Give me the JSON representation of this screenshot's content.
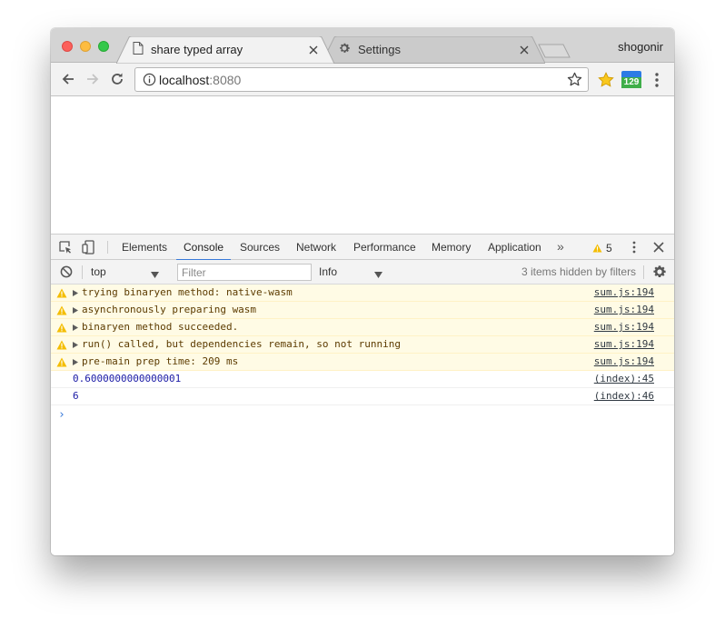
{
  "browser": {
    "tabs": [
      {
        "title": "share typed array",
        "icon": "document-icon",
        "active": true
      },
      {
        "title": "Settings",
        "icon": "gear-icon",
        "active": false
      }
    ],
    "profile_name": "shogonir",
    "address": {
      "host": "localhost",
      "port": ":8080"
    },
    "extensions": [
      {
        "name": "star-extension-icon"
      },
      {
        "name": "calendar-extension-icon",
        "badge": "129"
      }
    ]
  },
  "devtools": {
    "tabs": [
      "Elements",
      "Console",
      "Sources",
      "Network",
      "Performance",
      "Memory",
      "Application"
    ],
    "active_tab": "Console",
    "more_glyph": "»",
    "warning_count": "5",
    "filter_bar": {
      "context": "top",
      "filter_placeholder": "Filter",
      "level": "Info",
      "hidden_text": "3 items hidden by filters"
    },
    "messages": [
      {
        "type": "warn",
        "text": "trying binaryen method: native-wasm",
        "source": "sum.js:194"
      },
      {
        "type": "warn",
        "text": "asynchronously preparing wasm",
        "source": "sum.js:194"
      },
      {
        "type": "warn",
        "text": "binaryen method succeeded.",
        "source": "sum.js:194"
      },
      {
        "type": "warn",
        "text": "run() called, but dependencies remain, so not running",
        "source": "sum.js:194"
      },
      {
        "type": "warn",
        "text": "pre-main prep time: 209 ms",
        "source": "sum.js:194"
      },
      {
        "type": "log",
        "text": "0.6000000000000001",
        "source": "(index):45"
      },
      {
        "type": "log",
        "text": "6",
        "source": "(index):46"
      }
    ],
    "prompt_glyph": "›"
  },
  "colors": {
    "accent": "#3879d9",
    "warning_bg": "#fffbe5",
    "warning_icon": "#f4bd00",
    "log_text": "#1a1aa6"
  }
}
